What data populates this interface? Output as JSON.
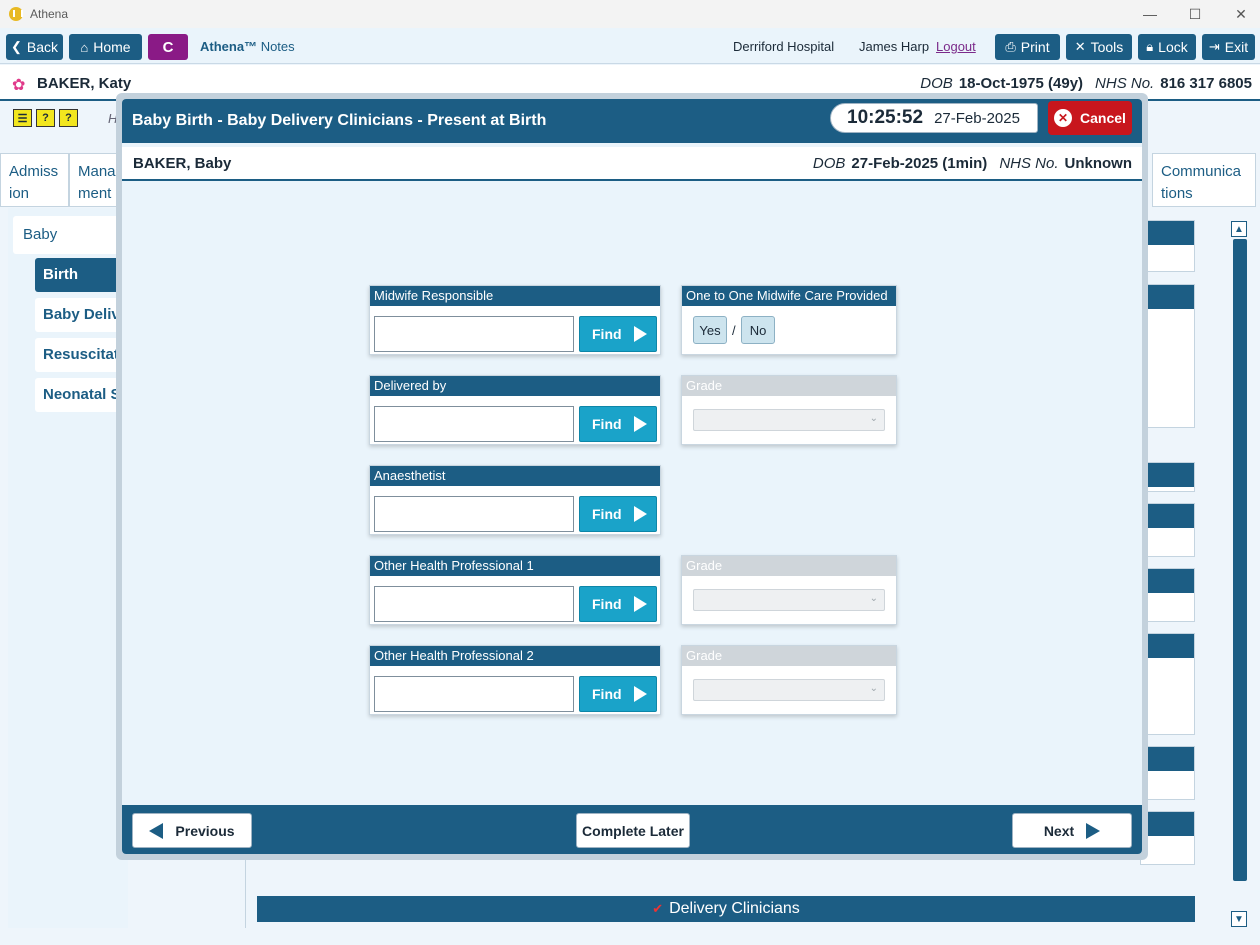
{
  "window": {
    "title": "Athena",
    "minimize_glyph": "—",
    "maximize_glyph": "☐",
    "close_glyph": "✕"
  },
  "toolbar": {
    "back": "Back",
    "home": "Home",
    "c_button": "C",
    "brand_name": "Athena™",
    "brand_suffix": "Notes",
    "hospital": "Derriford Hospital",
    "user": "James Harp",
    "logout": "Logout",
    "print": "Print",
    "tools": "Tools",
    "lock": "Lock",
    "exit": "Exit"
  },
  "patient": {
    "name": "BAKER, Katy",
    "dob_label": "DOB",
    "dob": "18-Oct-1975 (49y)",
    "nhs_label": "NHS No.",
    "nhs": "816 317 6805"
  },
  "background": {
    "h_text": "H",
    "tab_left_1": "Admiss ion",
    "tab_left_2": "Mana ment",
    "tab_right": "Communica tions",
    "sidebar_title": "Baby",
    "sidebar_items": [
      "Birth",
      "Baby Delivery Clinicians",
      "Resuscitation",
      "Neonatal Summary"
    ],
    "bottom_bar": "Delivery Clinicians",
    "bottom_tick": "✔"
  },
  "modal": {
    "title": "Baby Birth - Baby Delivery Clinicians - Present at Birth",
    "time": "10:25:52",
    "date": "27-Feb-2025",
    "cancel": "Cancel",
    "baby_name": "BAKER, Baby",
    "baby_dob_label": "DOB",
    "baby_dob": "27-Feb-2025 (1min)",
    "baby_nhs_label": "NHS No.",
    "baby_nhs": "Unknown"
  },
  "form": {
    "find_label": "Find",
    "midwife_label": "Midwife Responsible",
    "one_to_one_label": "One to One Midwife Care Provided",
    "yes": "Yes",
    "no": "No",
    "yes_no_separator": "/",
    "delivered_by_label": "Delivered by",
    "grade_label": "Grade",
    "anaesthetist_label": "Anaesthetist",
    "other1_label": "Other Health Professional 1",
    "other2_label": "Other Health Professional 2",
    "fields": {
      "midwife_value": "",
      "delivered_by_value": "",
      "anaesthetist_value": "",
      "other1_value": "",
      "other2_value": "",
      "grade_delivered": "",
      "grade_other1": "",
      "grade_other2": ""
    }
  },
  "footer": {
    "previous": "Previous",
    "complete_later": "Complete Later",
    "next": "Next"
  },
  "colors": {
    "primary": "#1c5d84",
    "find": "#1aa3c9",
    "cancel": "#c8161d",
    "c_button": "#8a1a86"
  }
}
